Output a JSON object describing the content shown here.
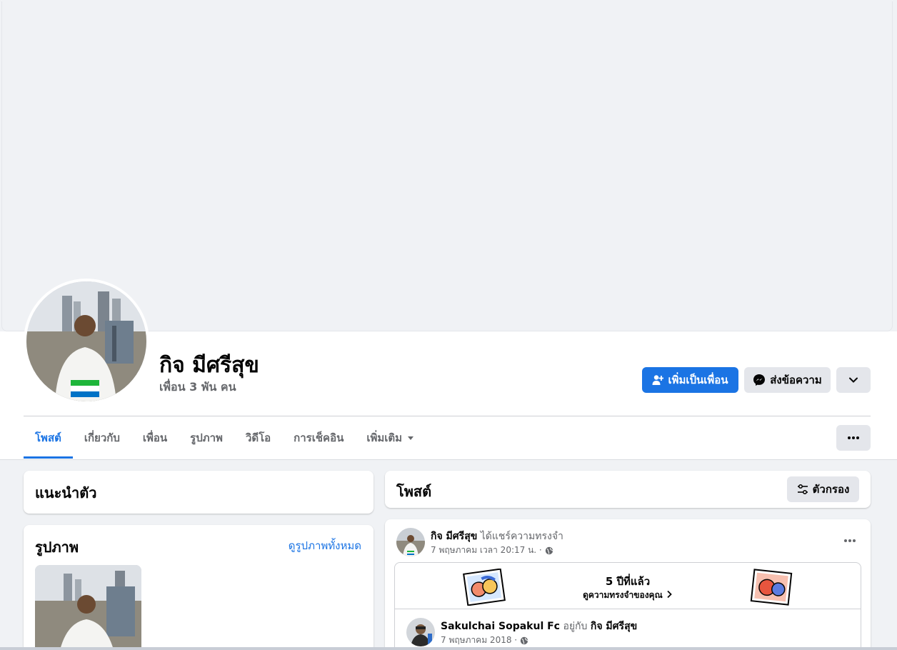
{
  "profile": {
    "name": "กิจ มีศรีสุข",
    "friends": "เพื่อน 3 พัน คน"
  },
  "actions": {
    "add_friend": "เพิ่มเป็นเพื่อน",
    "message": "ส่งข้อความ"
  },
  "tabs": [
    {
      "label": "โพสต์"
    },
    {
      "label": "เกี่ยวกับ"
    },
    {
      "label": "เพื่อน"
    },
    {
      "label": "รูปภาพ"
    },
    {
      "label": "วิดีโอ"
    },
    {
      "label": "การเช็คอิน"
    },
    {
      "label": "เพิ่มเติม"
    }
  ],
  "intro": {
    "title": "แนะนำตัว"
  },
  "photos": {
    "title": "รูปภาพ",
    "see_all": "ดูรูปภาพทั้งหมด"
  },
  "posts": {
    "title": "โพสต์",
    "filter": "ตัวกรอง",
    "item": {
      "author": "กิจ มีศรีสุข",
      "action": "ได้แชร์ความทรงจำ",
      "time": "7 พฤษภาคม เวลา 20:17 น. ·",
      "memory_years": "5 ปีที่แล้ว",
      "memory_link": "ดูความทรงจำของคุณ",
      "shared_author": "Sakulchai Sopakul Fc",
      "shared_with_word": "อยู่กับ",
      "shared_with": "กิจ มีศรีสุข",
      "shared_time": "7 พฤษภาคม 2018 ·"
    }
  },
  "colors": {
    "accent": "#1b74e4",
    "background": "#f0f2f5",
    "secondary_button": "#e4e6eb"
  }
}
